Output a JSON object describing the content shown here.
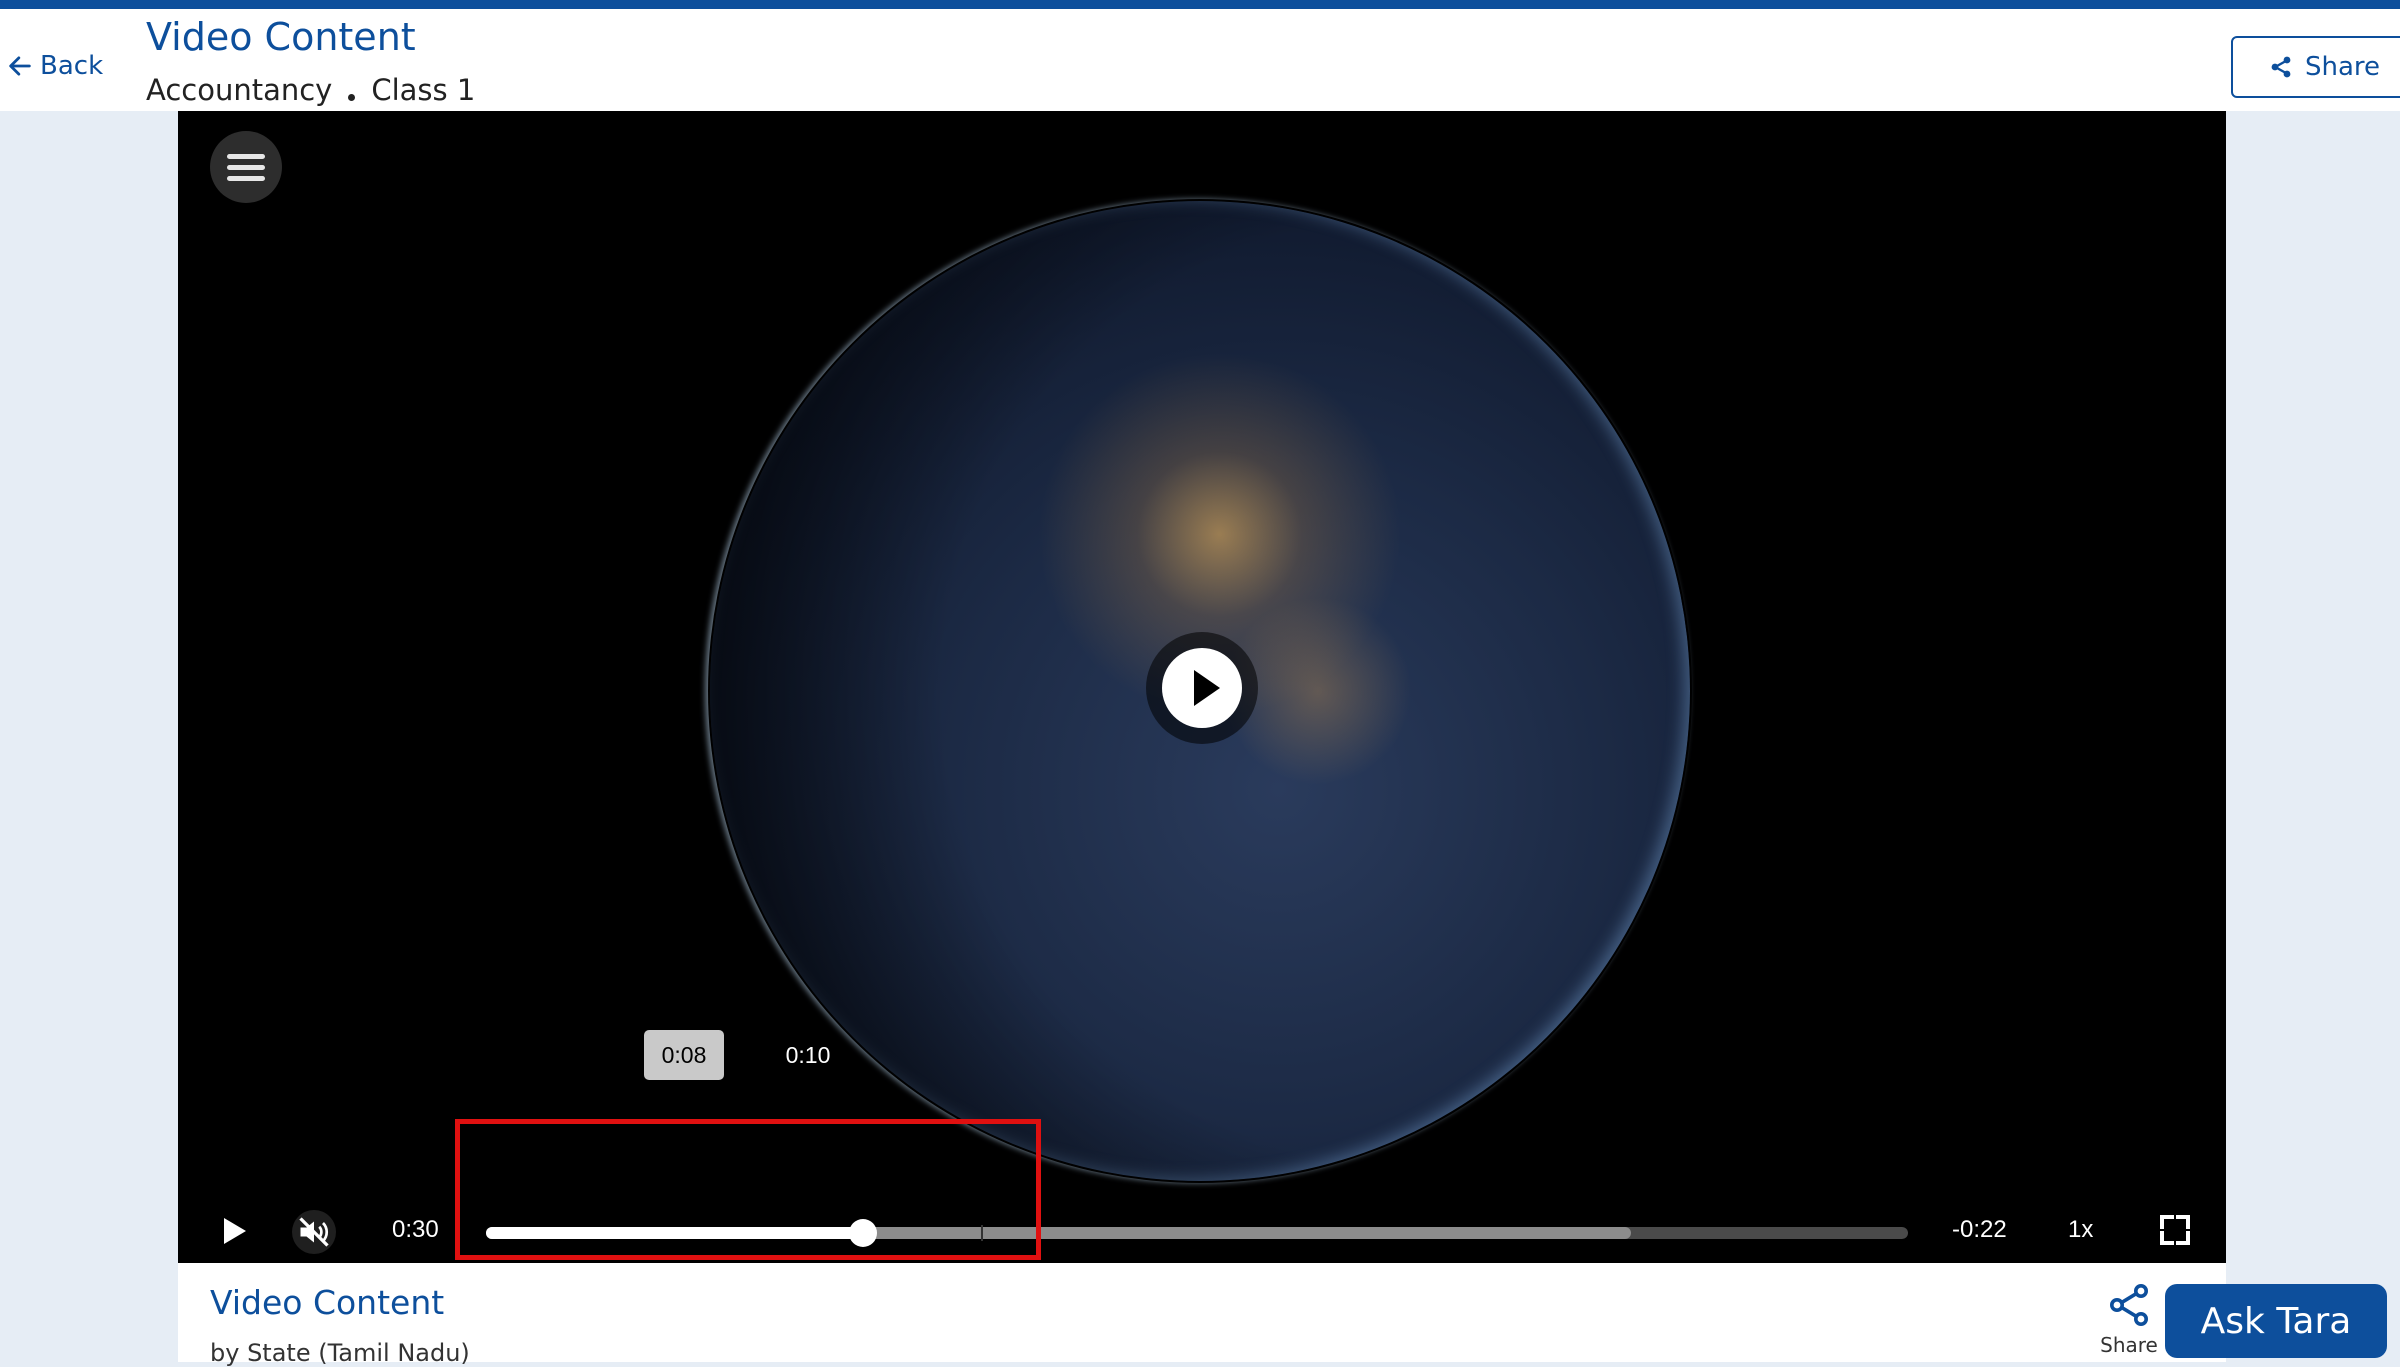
{
  "header": {
    "back_label": "Back",
    "title": "Video Content",
    "breadcrumb": [
      "Accountancy",
      "Class 1"
    ],
    "share_label": "Share"
  },
  "player": {
    "current_time": "0:30",
    "remaining_time": "-0:22",
    "speed": "1x",
    "thumb_tooltip": "0:08",
    "hover_tooltip": "0:10",
    "played_fraction": 0.265,
    "buffered_fraction": 0.805,
    "hover_fraction": 0.348,
    "muted": true
  },
  "info": {
    "title": "Video Content",
    "subtitle": "by State (Tamil Nadu)",
    "share_label": "Share"
  },
  "ask_tara": "Ask Tara",
  "colors": {
    "brand": "#0d4f9c",
    "highlight": "#e01010"
  },
  "icons": [
    "arrow-left-icon",
    "share-icon",
    "menu-icon",
    "play-icon",
    "mute-icon",
    "fullscreen-icon"
  ]
}
